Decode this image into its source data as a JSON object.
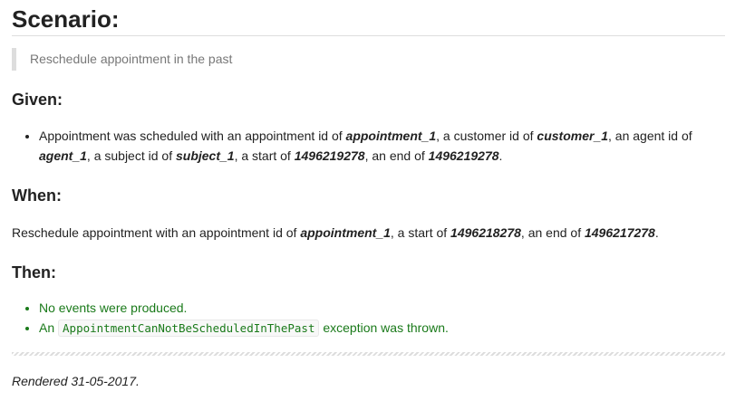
{
  "title": "Scenario:",
  "description": "Reschedule appointment in the past",
  "given": {
    "heading": "Given:",
    "items": [
      {
        "t1": "Appointment was scheduled with an appointment id of ",
        "v1": "appointment_1",
        "t2": ", a customer id of ",
        "v2": "customer_1",
        "t3": ", an agent id of ",
        "v3": "agent_1",
        "t4": ", a subject id of ",
        "v4": "subject_1",
        "t5": ", a start of ",
        "v5": "1496219278",
        "t6": ", an end of ",
        "v6": "1496219278",
        "t7": "."
      }
    ]
  },
  "when": {
    "heading": "When:",
    "t1": "Reschedule appointment with an appointment id of ",
    "v1": "appointment_1",
    "t2": ", a start of ",
    "v2": "1496218278",
    "t3": ", an end of ",
    "v3": "1496217278",
    "t4": "."
  },
  "then": {
    "heading": "Then:",
    "item1": "No events were produced.",
    "item2_prefix": "An ",
    "item2_code": "AppointmentCanNotBeScheduledInThePast",
    "item2_suffix": " exception was thrown."
  },
  "footer": {
    "rendered": "Rendered 31-05-2017."
  },
  "colors": {
    "success": "#1a7a1a",
    "muted": "#777777",
    "rule": "#dddddd"
  }
}
